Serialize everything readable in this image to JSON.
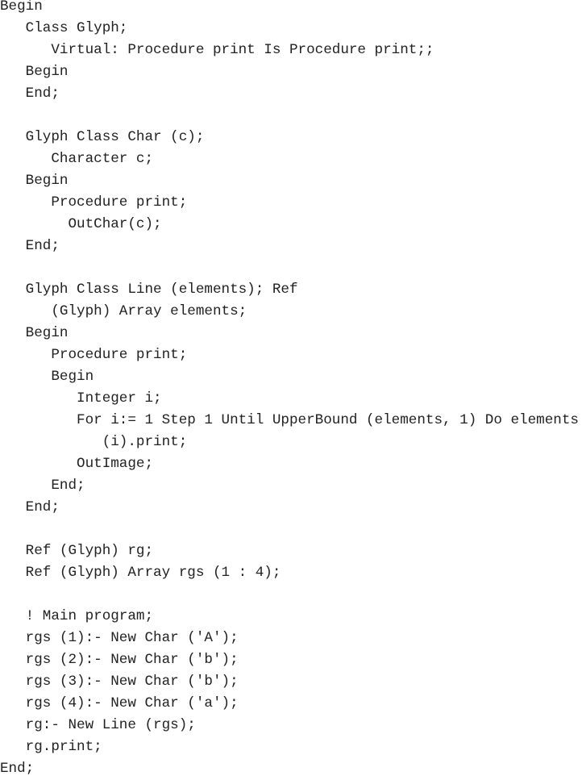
{
  "code": {
    "lines": [
      "Begin",
      "   Class Glyph;",
      "      Virtual: Procedure print Is Procedure print;;",
      "   Begin",
      "   End;",
      "",
      "   Glyph Class Char (c);",
      "      Character c;",
      "   Begin",
      "      Procedure print;",
      "        OutChar(c);",
      "   End;",
      "",
      "   Glyph Class Line (elements); Ref",
      "      (Glyph) Array elements;",
      "   Begin",
      "      Procedure print;",
      "      Begin",
      "         Integer i;",
      "         For i:= 1 Step 1 Until UpperBound (elements, 1) Do elements",
      "            (i).print;",
      "         OutImage;",
      "      End;",
      "   End;",
      "",
      "   Ref (Glyph) rg;",
      "   Ref (Glyph) Array rgs (1 : 4);",
      "",
      "   ! Main program;",
      "   rgs (1):- New Char ('A');",
      "   rgs (2):- New Char ('b');",
      "   rgs (3):- New Char ('b');",
      "   rgs (4):- New Char ('a');",
      "   rg:- New Line (rgs);",
      "   rg.print;",
      "End;"
    ]
  }
}
